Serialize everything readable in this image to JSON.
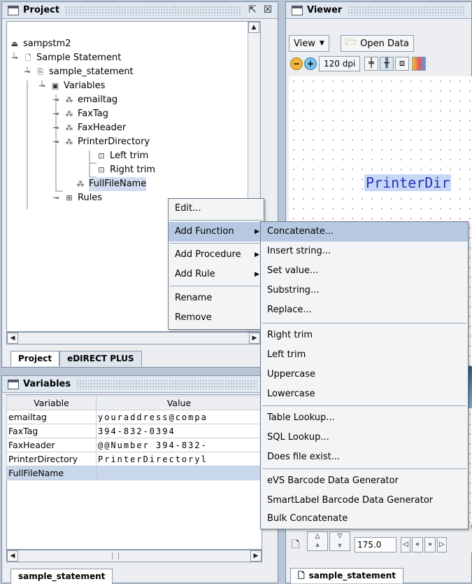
{
  "project_panel": {
    "title": "Project",
    "tree": {
      "root": "sampstm2",
      "statement": "Sample Statement",
      "node": "sample_statement",
      "variables": "Variables",
      "emailtag": "emailtag",
      "faxtag": "FaxTag",
      "faxheader": "FaxHeader",
      "printerdirectory": "PrinterDirectory",
      "lefttrim": "Left trim",
      "righttrim": "Right trim",
      "fullfilename": "FullFileName",
      "rules": "Rules"
    },
    "tabs": [
      "Project",
      "eDIRECT PLUS"
    ]
  },
  "variables_panel": {
    "title": "Variables",
    "headers": [
      "Variable",
      "Value"
    ],
    "rows": [
      [
        "emailtag",
        "youraddress@compa"
      ],
      [
        "FaxTag",
        "394-832-0394"
      ],
      [
        "FaxHeader",
        "@@Number 394-832-"
      ],
      [
        "PrinterDirectory",
        "PrinterDirectoryl"
      ],
      [
        "FullFileName",
        ""
      ]
    ],
    "tab": "sample_statement"
  },
  "viewer_panel": {
    "title": "Viewer",
    "view_menu": "View",
    "open_data": "Open Data",
    "dpi": "120 dpi",
    "preview_text": "PrinterDir",
    "zoom_value": "175.0",
    "tab": "sample_statement"
  },
  "context_menu": {
    "items": [
      "Edit...",
      "Add Function",
      "Add Procedure",
      "Add Rule",
      "Rename",
      "Remove"
    ]
  },
  "function_submenu": {
    "items": [
      "Concatenate...",
      "Insert string...",
      "Set value...",
      "Substring...",
      "Replace...",
      "Right trim",
      "Left trim",
      "Uppercase",
      "Lowercase",
      "Table Lookup...",
      "SQL Lookup...",
      "Does file exist...",
      "eVS Barcode Data Generator",
      "SmartLabel Barcode Data Generator",
      "Bulk Concatenate"
    ]
  }
}
